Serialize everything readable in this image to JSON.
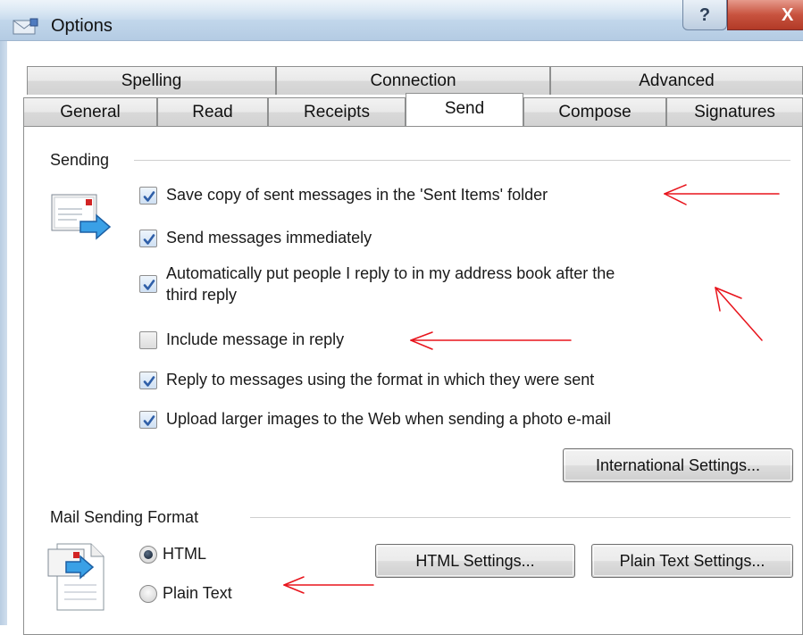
{
  "window": {
    "title": "Options",
    "help_label": "?",
    "close_label": "X"
  },
  "tabs": {
    "row_top": [
      {
        "label": "Spelling"
      },
      {
        "label": "Connection"
      },
      {
        "label": "Advanced"
      }
    ],
    "row_bottom": [
      {
        "label": "General"
      },
      {
        "label": "Read"
      },
      {
        "label": "Receipts"
      },
      {
        "label": "Send",
        "active": true
      },
      {
        "label": "Compose"
      },
      {
        "label": "Signatures"
      }
    ]
  },
  "sending": {
    "title": "Sending",
    "options": [
      {
        "label": "Save copy of sent messages in the 'Sent Items' folder",
        "checked": true
      },
      {
        "label": "Send messages immediately",
        "checked": true
      },
      {
        "label": "Automatically put people I reply to in my address book after the",
        "label_line2": "third reply",
        "checked": true
      },
      {
        "label": "Include message in reply",
        "checked": false
      },
      {
        "label": "Reply to messages using the format in which they were sent",
        "checked": true
      },
      {
        "label": "Upload larger images to the Web when sending a photo e-mail",
        "checked": true
      }
    ],
    "international_button": "International Settings..."
  },
  "mail_format": {
    "title": "Mail Sending Format",
    "html_label": "HTML",
    "plain_label": "Plain Text",
    "selected": "HTML",
    "html_settings_button": "HTML Settings...",
    "plain_settings_button": "Plain Text Settings..."
  },
  "colors": {
    "annotation_red": "#e8141c",
    "check_blue": "#2f5fa8",
    "close_red": "#c8533f"
  },
  "icons": {
    "title": "mail-options-icon",
    "sending": "send-mail-icon",
    "format": "mail-format-icon"
  }
}
